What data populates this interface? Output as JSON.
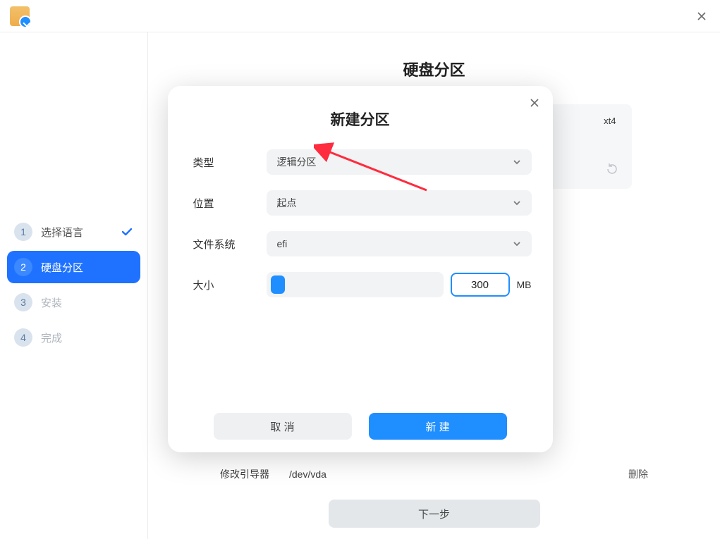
{
  "titlebar": {
    "close_aria": "close"
  },
  "sidebar": {
    "steps": [
      {
        "num": "1",
        "label": "选择语言",
        "done": true
      },
      {
        "num": "2",
        "label": "硬盘分区",
        "active": true
      },
      {
        "num": "3",
        "label": "安装"
      },
      {
        "num": "4",
        "label": "完成"
      }
    ]
  },
  "page": {
    "title": "硬盘分区"
  },
  "disk": {
    "label_visible": "xt4"
  },
  "boot": {
    "label": "修改引导器",
    "device": "/dev/vda",
    "delete": "删除"
  },
  "next_button": "下一步",
  "modal": {
    "title": "新建分区",
    "close_aria": "close",
    "fields": {
      "type_label": "类型",
      "type_value": "逻辑分区",
      "location_label": "位置",
      "location_value": "起点",
      "fs_label": "文件系统",
      "fs_value": "efi",
      "size_label": "大小",
      "size_value": "300",
      "size_unit": "MB"
    },
    "cancel": "取 消",
    "create": "新 建"
  }
}
